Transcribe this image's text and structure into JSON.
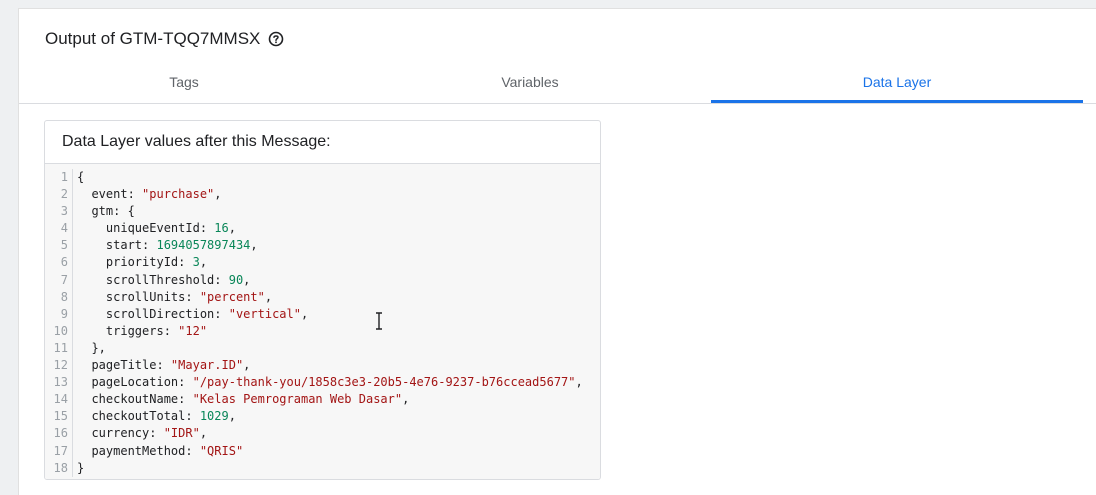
{
  "header": {
    "title": "Output of GTM-TQQ7MMSX",
    "help_icon": "help-circle-icon"
  },
  "tabs": [
    {
      "label": "Tags",
      "active": false
    },
    {
      "label": "Variables",
      "active": false
    },
    {
      "label": "Data Layer",
      "active": true
    }
  ],
  "accent_color": "#1a73e8",
  "card": {
    "title": "Data Layer values after this Message:"
  },
  "code_lines": [
    {
      "n": "1",
      "parts": [
        [
          "p",
          "{"
        ]
      ]
    },
    {
      "n": "2",
      "parts": [
        [
          "p",
          "  event: "
        ],
        [
          "s",
          "\"purchase\""
        ],
        [
          "p",
          ","
        ]
      ]
    },
    {
      "n": "3",
      "parts": [
        [
          "p",
          "  gtm: {"
        ]
      ]
    },
    {
      "n": "4",
      "parts": [
        [
          "p",
          "    uniqueEventId: "
        ],
        [
          "n",
          "16"
        ],
        [
          "p",
          ","
        ]
      ]
    },
    {
      "n": "5",
      "parts": [
        [
          "p",
          "    start: "
        ],
        [
          "n",
          "1694057897434"
        ],
        [
          "p",
          ","
        ]
      ]
    },
    {
      "n": "6",
      "parts": [
        [
          "p",
          "    priorityId: "
        ],
        [
          "n",
          "3"
        ],
        [
          "p",
          ","
        ]
      ]
    },
    {
      "n": "7",
      "parts": [
        [
          "p",
          "    scrollThreshold: "
        ],
        [
          "n",
          "90"
        ],
        [
          "p",
          ","
        ]
      ]
    },
    {
      "n": "8",
      "parts": [
        [
          "p",
          "    scrollUnits: "
        ],
        [
          "s",
          "\"percent\""
        ],
        [
          "p",
          ","
        ]
      ]
    },
    {
      "n": "9",
      "parts": [
        [
          "p",
          "    scrollDirection: "
        ],
        [
          "s",
          "\"vertical\""
        ],
        [
          "p",
          ","
        ]
      ]
    },
    {
      "n": "10",
      "parts": [
        [
          "p",
          "    triggers: "
        ],
        [
          "s",
          "\"12\""
        ]
      ]
    },
    {
      "n": "11",
      "parts": [
        [
          "p",
          "  },"
        ]
      ]
    },
    {
      "n": "12",
      "parts": [
        [
          "p",
          "  pageTitle: "
        ],
        [
          "s",
          "\"Mayar.ID\""
        ],
        [
          "p",
          ","
        ]
      ]
    },
    {
      "n": "13",
      "parts": [
        [
          "p",
          "  pageLocation: "
        ],
        [
          "s",
          "\"/pay-thank-you/1858c3e3-20b5-4e76-9237-b76ccead5677\""
        ],
        [
          "p",
          ","
        ]
      ]
    },
    {
      "n": "14",
      "parts": [
        [
          "p",
          "  checkoutName: "
        ],
        [
          "s",
          "\"Kelas Pemrograman Web Dasar\""
        ],
        [
          "p",
          ","
        ]
      ]
    },
    {
      "n": "15",
      "parts": [
        [
          "p",
          "  checkoutTotal: "
        ],
        [
          "n",
          "1029"
        ],
        [
          "p",
          ","
        ]
      ]
    },
    {
      "n": "16",
      "parts": [
        [
          "p",
          "  currency: "
        ],
        [
          "s",
          "\"IDR\""
        ],
        [
          "p",
          ","
        ]
      ]
    },
    {
      "n": "17",
      "parts": [
        [
          "p",
          "  paymentMethod: "
        ],
        [
          "s",
          "\"QRIS\""
        ]
      ]
    },
    {
      "n": "18",
      "parts": [
        [
          "p",
          "}"
        ]
      ]
    }
  ]
}
